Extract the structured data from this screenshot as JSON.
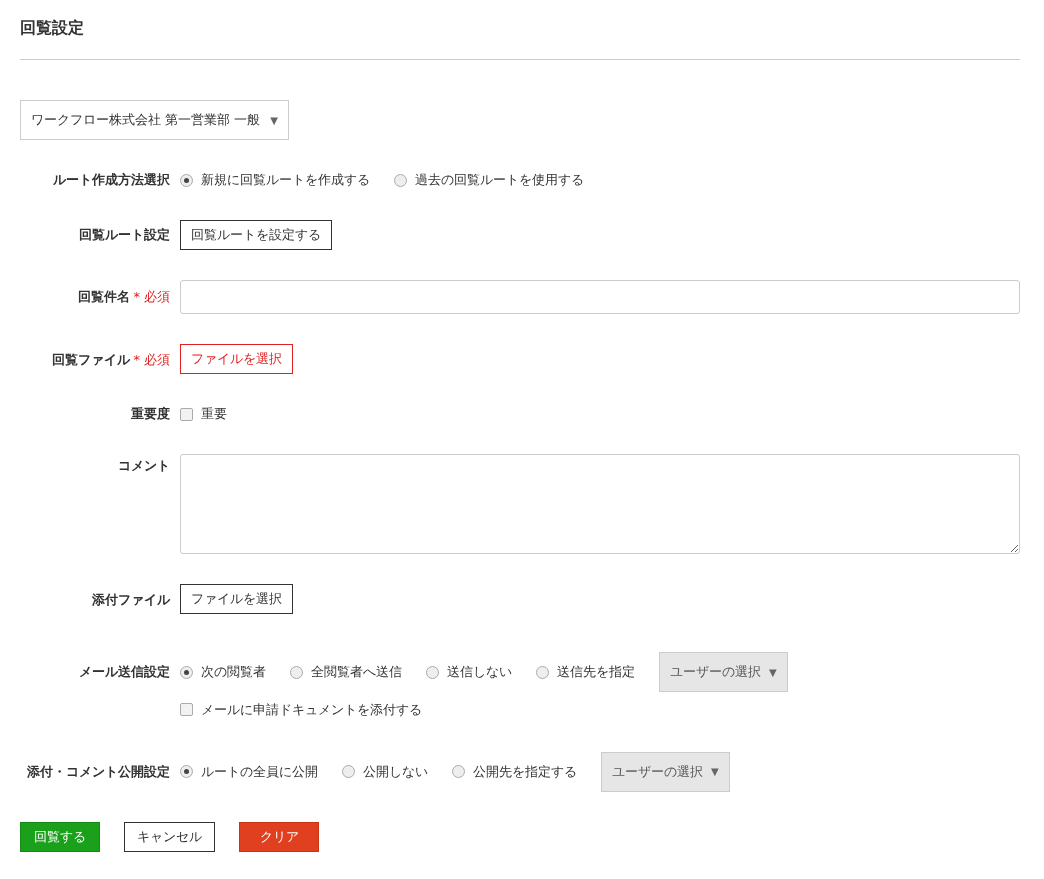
{
  "title": "回覧設定",
  "org_select": {
    "value": "ワークフロー株式会社 第一営業部 一般",
    "caret": "▼"
  },
  "rows": [
    {
      "kind": "radio",
      "label": "ルート作成方法選択",
      "options": [
        {
          "label": "新規に回覧ルートを作成する",
          "selected": true
        },
        {
          "label": "過去の回覧ルートを使用する",
          "selected": false
        }
      ]
    },
    {
      "kind": "button",
      "label": "回覧ルート設定",
      "button": "回覧ルートを設定する"
    },
    {
      "kind": "text",
      "label": "回覧件名",
      "required": true,
      "required_mark": "*",
      "required_text": "必須"
    },
    {
      "kind": "file",
      "label": "回覧ファイル",
      "required": true,
      "required_mark": "*",
      "required_text": "必須",
      "button": "ファイルを選択"
    },
    {
      "kind": "checkbox",
      "label": "重要度",
      "options": [
        {
          "label": "重要",
          "checked": false
        }
      ]
    },
    {
      "kind": "textarea",
      "label": "コメント"
    },
    {
      "kind": "file",
      "label": "添付ファイル",
      "required": false,
      "button": "ファイルを選択"
    },
    {
      "kind": "radio",
      "label": "メール送信設定",
      "options": [
        {
          "label": "次の閲覧者",
          "selected": true
        },
        {
          "label": "全閲覧者へ送信",
          "selected": false
        },
        {
          "label": "送信しない",
          "selected": false
        },
        {
          "label": "送信先を指定",
          "selected": false
        }
      ],
      "dropdown": {
        "value": "ユーザーの選択",
        "caret": "▼"
      },
      "extra_checkbox": {
        "label": "メールに申請ドキュメントを添付する",
        "checked": false
      }
    },
    {
      "kind": "radio",
      "label": "添付・コメント公開設定",
      "options": [
        {
          "label": "ルートの全員に公開",
          "selected": true
        },
        {
          "label": "公開しない",
          "selected": false
        },
        {
          "label": "公開先を指定する",
          "selected": false
        }
      ],
      "dropdown": {
        "value": "ユーザーの選択",
        "caret": "▼"
      }
    }
  ],
  "buttons": [
    {
      "label": "回覧する",
      "kind": "primary"
    },
    {
      "label": "キャンセル",
      "kind": "default"
    },
    {
      "label": "クリア",
      "kind": "danger"
    }
  ]
}
